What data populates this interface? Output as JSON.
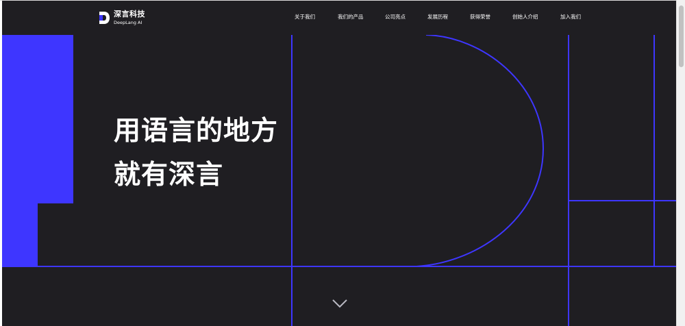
{
  "brand": {
    "name_cn": "深言科技",
    "name_en": "DeepLang AI",
    "accent": "#3e36ff",
    "background": "#1f1e22"
  },
  "nav": {
    "items": [
      {
        "label": "关于我们"
      },
      {
        "label": "我们的产品"
      },
      {
        "label": "公司亮点"
      },
      {
        "label": "发展历程"
      },
      {
        "label": "获得荣誉"
      },
      {
        "label": "创始人介绍"
      },
      {
        "label": "加入我们"
      }
    ]
  },
  "hero": {
    "title_line1": "用语言的地方",
    "title_line2": "就有深言"
  },
  "icons": {
    "scroll": "chevron-down-icon",
    "logo": "deeplang-logo-icon"
  }
}
